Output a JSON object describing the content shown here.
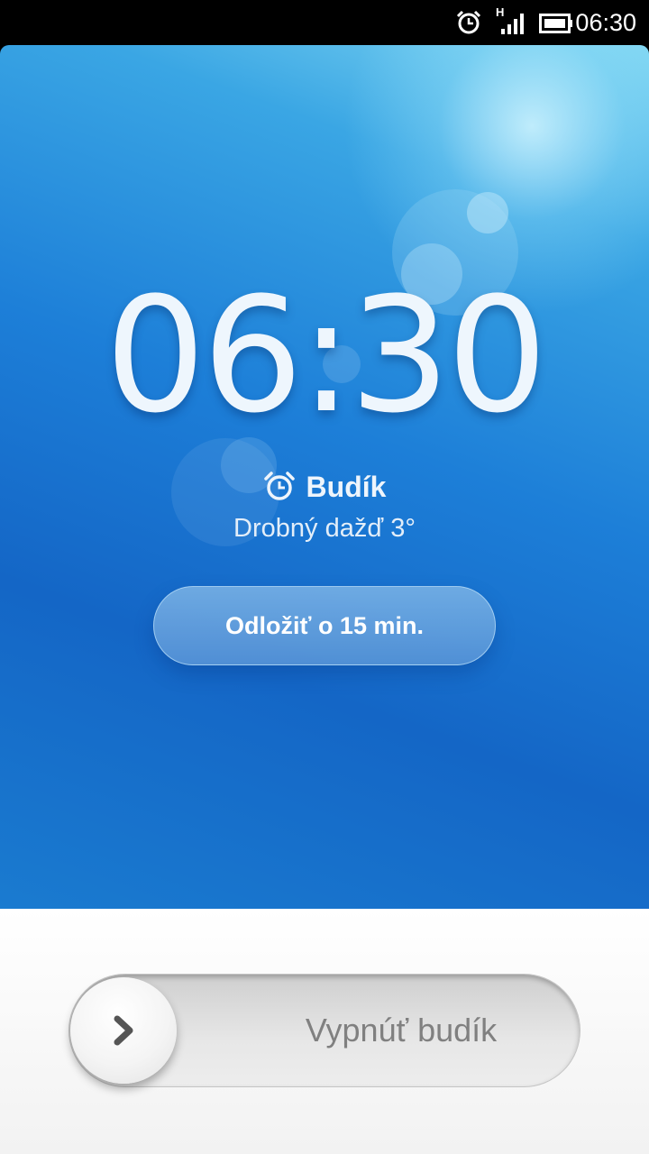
{
  "status_bar": {
    "time": "06:30",
    "network_type": "H",
    "icons": [
      "alarm-icon",
      "signal-icon",
      "battery-icon"
    ]
  },
  "alarm": {
    "time": "06:30",
    "label": "Budík",
    "weather": "Drobný dažď 3°",
    "snooze_label": "Odložiť o 15 min.",
    "dismiss_label": "Vypnúť budík"
  },
  "colors": {
    "background_top": "#7fd6f2",
    "background_main": "#1466c6",
    "panel": "#f2f2f2",
    "slider_text": "#808080"
  }
}
